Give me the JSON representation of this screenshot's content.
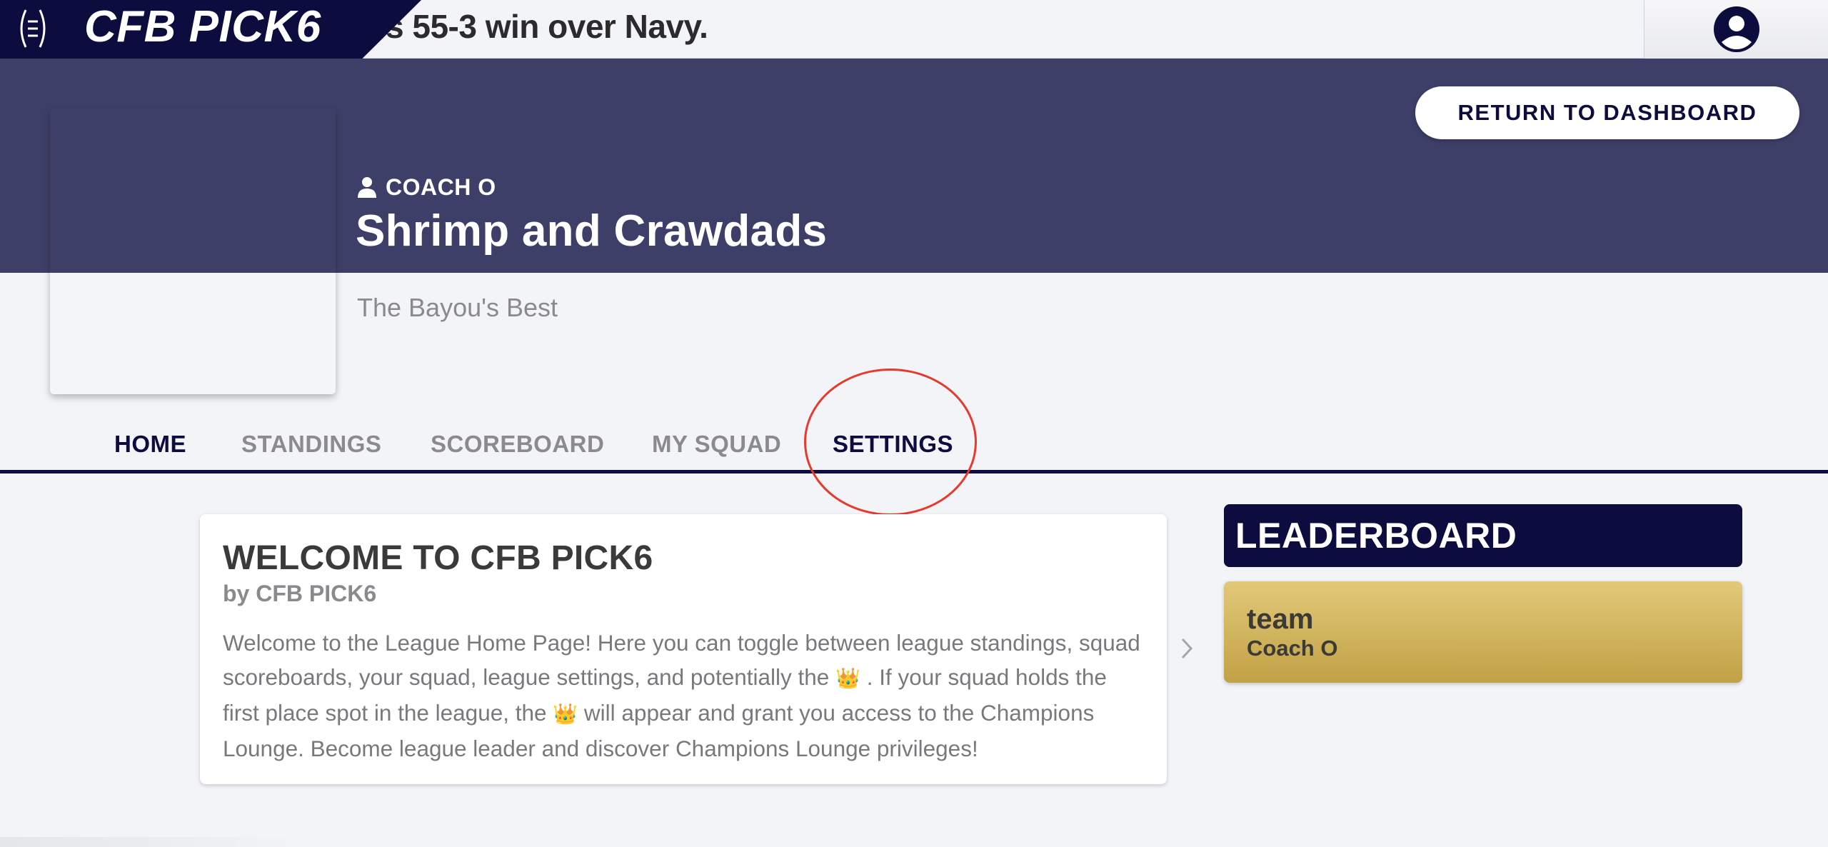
{
  "header": {
    "brand": "CFB PICK6",
    "ticker_text": "s 55-3 win over Navy.",
    "menu_icon": "menu-icon",
    "account_icon": "account-circle-icon"
  },
  "hero": {
    "return_button": "RETURN TO DASHBOARD",
    "coach_name": "COACH O",
    "coach_icon": "person-icon",
    "league_name": "Shrimp and Crawdads",
    "motto": "The Bayou's Best"
  },
  "tabs": [
    {
      "label": "HOME",
      "active": true
    },
    {
      "label": "STANDINGS",
      "active": false
    },
    {
      "label": "SCOREBOARD",
      "active": false
    },
    {
      "label": "MY SQUAD",
      "active": false
    },
    {
      "label": "SETTINGS",
      "active": false
    }
  ],
  "welcome": {
    "title": "WELCOME TO CFB PICK6",
    "byline": "by CFB PICK6",
    "body_part1": "Welcome to the League Home Page! Here you can toggle between league standings, squad scoreboards, your squad, league settings, and potentially the ",
    "crown_emoji": "👑",
    "body_part2": " . If your squad holds the first place spot in the league, the ",
    "body_part3": "  will appear and grant you access to the Champions Lounge. Become league leader and discover Champions Lounge privileges!"
  },
  "leaderboard": {
    "title": "LEADERBOARD",
    "entries": [
      {
        "team": "team",
        "coach": "Coach O"
      }
    ]
  },
  "colors": {
    "navy": "#0c0c3f",
    "hero": "#3e3f68",
    "background": "#f3f4f8",
    "gold": "#d4b35e",
    "highlight_circle": "#e53a2c"
  }
}
